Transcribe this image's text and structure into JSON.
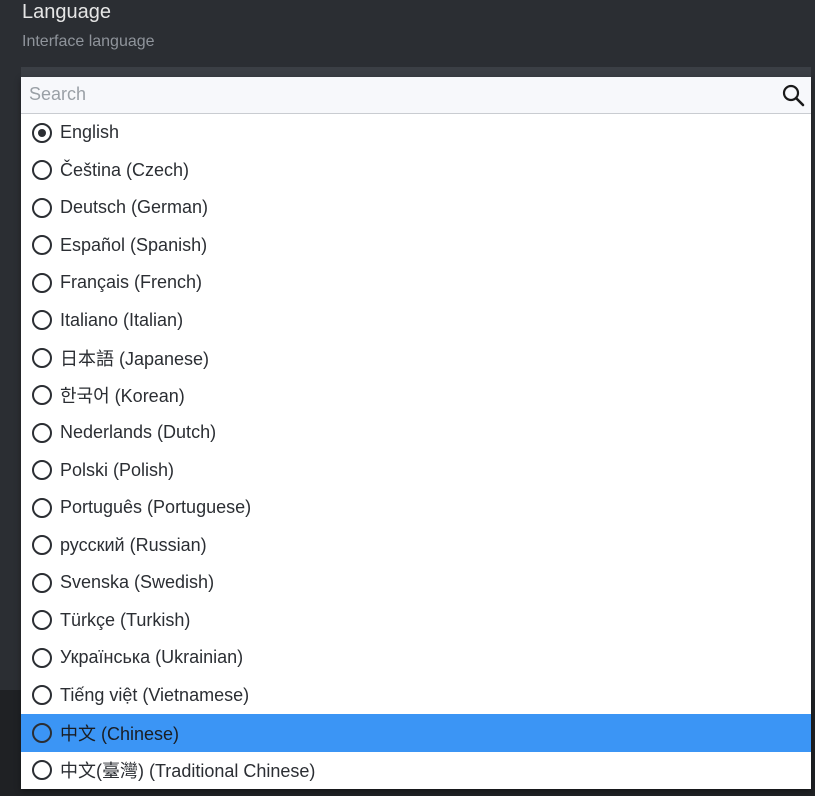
{
  "setting": {
    "title": "Language",
    "subtitle": "Interface language"
  },
  "search": {
    "placeholder": "Search",
    "icon": "search-icon"
  },
  "options": [
    {
      "label": "English",
      "checked": true,
      "highlighted": false
    },
    {
      "label": "Čeština (Czech)",
      "checked": false,
      "highlighted": false
    },
    {
      "label": "Deutsch (German)",
      "checked": false,
      "highlighted": false
    },
    {
      "label": "Español (Spanish)",
      "checked": false,
      "highlighted": false
    },
    {
      "label": "Français (French)",
      "checked": false,
      "highlighted": false
    },
    {
      "label": "Italiano (Italian)",
      "checked": false,
      "highlighted": false
    },
    {
      "label": "日本語 (Japanese)",
      "checked": false,
      "highlighted": false
    },
    {
      "label": "한국어 (Korean)",
      "checked": false,
      "highlighted": false
    },
    {
      "label": "Nederlands (Dutch)",
      "checked": false,
      "highlighted": false
    },
    {
      "label": "Polski (Polish)",
      "checked": false,
      "highlighted": false
    },
    {
      "label": "Português (Portuguese)",
      "checked": false,
      "highlighted": false
    },
    {
      "label": "русский (Russian)",
      "checked": false,
      "highlighted": false
    },
    {
      "label": "Svenska (Swedish)",
      "checked": false,
      "highlighted": false
    },
    {
      "label": "Türkçe (Turkish)",
      "checked": false,
      "highlighted": false
    },
    {
      "label": "Українська (Ukrainian)",
      "checked": false,
      "highlighted": false
    },
    {
      "label": "Tiếng việt (Vietnamese)",
      "checked": false,
      "highlighted": false
    },
    {
      "label": "中文 (Chinese)",
      "checked": false,
      "highlighted": true
    },
    {
      "label": "中文(臺灣) (Traditional Chinese)",
      "checked": false,
      "highlighted": false
    }
  ],
  "colors": {
    "background": "#2b2e33",
    "highlight": "#3b95f5",
    "dropdown_bg": "#ffffff"
  }
}
